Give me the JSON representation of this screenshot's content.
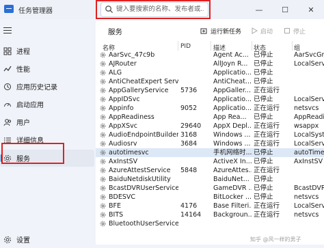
{
  "app": {
    "title": "任务管理器"
  },
  "search": {
    "placeholder": "键入要搜索的名称、发布者或..."
  },
  "window_controls": {
    "minimize": "—",
    "maximize": "☐",
    "close": "✕"
  },
  "sidebar": {
    "items": [
      {
        "label": "进程",
        "icon": "processes-grid-icon"
      },
      {
        "label": "性能",
        "icon": "performance-chart-icon"
      },
      {
        "label": "应用历史记录",
        "icon": "app-history-icon"
      },
      {
        "label": "启动应用",
        "icon": "startup-speedometer-icon"
      },
      {
        "label": "用户",
        "icon": "users-icon"
      },
      {
        "label": "详细信息",
        "icon": "details-list-icon"
      },
      {
        "label": "服务",
        "icon": "services-gear-icon",
        "active": true
      }
    ],
    "settings_label": "设置"
  },
  "page": {
    "title": "服务"
  },
  "toolbar": {
    "run_task": "运行新任务",
    "start": "启动",
    "stop": "停止"
  },
  "table": {
    "columns": [
      "名称",
      "PID",
      "描述",
      "状态",
      "组"
    ],
    "rows": [
      {
        "name": "AarSvc_47c9b",
        "pid": "",
        "desc": "Agent Ac...",
        "status": "已停止",
        "group": "AarSvcGr"
      },
      {
        "name": "AJRouter",
        "pid": "",
        "desc": "AllJoyn R...",
        "status": "已停止",
        "group": "LocalServ"
      },
      {
        "name": "ALG",
        "pid": "",
        "desc": "Applicatio...",
        "status": "已停止",
        "group": ""
      },
      {
        "name": "AntiCheatExpert Service",
        "pid": "",
        "desc": "AntiCheat...",
        "status": "已停止",
        "group": ""
      },
      {
        "name": "AppGalleryService",
        "pid": "5736",
        "desc": "AppGaller...",
        "status": "正在运行",
        "group": ""
      },
      {
        "name": "AppIDSvc",
        "pid": "",
        "desc": "Applicatio...",
        "status": "已停止",
        "group": "LocalServ"
      },
      {
        "name": "Appinfo",
        "pid": "9052",
        "desc": "Applicatio...",
        "status": "正在运行",
        "group": "netsvcs"
      },
      {
        "name": "AppReadiness",
        "pid": "",
        "desc": "App Rea...",
        "status": "已停止",
        "group": "AppReadin"
      },
      {
        "name": "AppXSvc",
        "pid": "29640",
        "desc": "AppX Depl...",
        "status": "正在运行",
        "group": "wsappx"
      },
      {
        "name": "AudioEndpointBuilder",
        "pid": "3168",
        "desc": "Windows ...",
        "status": "正在运行",
        "group": "LocalSyste"
      },
      {
        "name": "Audiosrv",
        "pid": "3684",
        "desc": "Windows ...",
        "status": "正在运行",
        "group": "LocalServ"
      },
      {
        "name": "autotimesvc",
        "pid": "",
        "desc": "手机网络时...",
        "status": "已停止",
        "group": "autoTime",
        "selected": true
      },
      {
        "name": "AxInstSV",
        "pid": "",
        "desc": "ActiveX In...",
        "status": "已停止",
        "group": "AxInstSV"
      },
      {
        "name": "AzureAttestService",
        "pid": "5848",
        "desc": "AzureAttes...",
        "status": "正在运行",
        "group": ""
      },
      {
        "name": "BaiduNetdiskUtility",
        "pid": "",
        "desc": "BaiduNet...",
        "status": "已停止",
        "group": ""
      },
      {
        "name": "BcastDVRUserService_...",
        "pid": "",
        "desc": "GameDVR ...",
        "status": "已停止",
        "group": "BcastDVR"
      },
      {
        "name": "BDESVC",
        "pid": "",
        "desc": "BitLocker ...",
        "status": "已停止",
        "group": "netsvcs"
      },
      {
        "name": "BFE",
        "pid": "4176",
        "desc": "Base Filteri...",
        "status": "正在运行",
        "group": "LocalServ"
      },
      {
        "name": "BITS",
        "pid": "14164",
        "desc": "Backgroun...",
        "status": "正在运行",
        "group": "netsvcs"
      },
      {
        "name": "BluetoothUserService...",
        "pid": "",
        "desc": "",
        "status": "",
        "group": ""
      }
    ]
  },
  "watermark": "知乎 @风一样的男子"
}
